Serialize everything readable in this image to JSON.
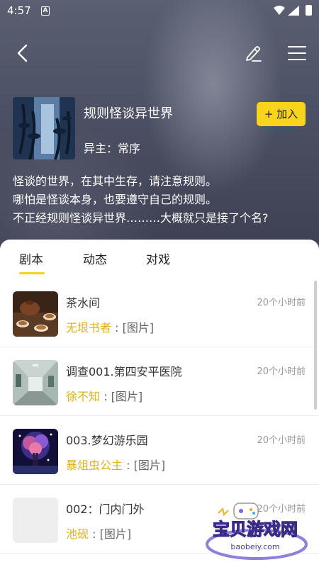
{
  "status_bar": {
    "time": "4:57",
    "app_badge": "A"
  },
  "world": {
    "title": "规则怪谈异世界",
    "owner_label": "异主：",
    "owner_name": "常序",
    "join_label": "+ 加入",
    "description": [
      "怪谈的世界，在其中生存，请注意规则。",
      "哪怕是怪谈本身，也要遵守自己的规则。",
      "不正经规则怪谈异世界………大概就只是接了个名?"
    ]
  },
  "tabs": [
    {
      "label": "剧本",
      "active": true
    },
    {
      "label": "动态",
      "active": false
    },
    {
      "label": "对戏",
      "active": false
    }
  ],
  "scripts": [
    {
      "title": "茶水间",
      "time": "20个小时前",
      "author": "无垠书者",
      "separator": " : ",
      "content": "[图片]",
      "thumb": "tea-set-image"
    },
    {
      "title": "调查001.第四安平医院",
      "time": "20个小时前",
      "author": "徐不知",
      "separator": " : ",
      "content": "[图片]",
      "thumb": "hospital-corridor-image"
    },
    {
      "title": "003.梦幻游乐园",
      "time": "20个小时前",
      "author": "暴俎虫公主",
      "separator": " : ",
      "content": "[图片]",
      "thumb": "glowing-tree-image"
    },
    {
      "title": "002：门内门外",
      "time": "20个小时前",
      "author": "池砚",
      "separator": " : ",
      "content": "[图片]",
      "thumb": "blank-image"
    }
  ],
  "watermark": {
    "text": "宝贝游戏网",
    "url": "baobeiy.com"
  },
  "colors": {
    "accent": "#f8d51c",
    "author": "#e0b21a",
    "hero_bg": "#4c5064"
  }
}
